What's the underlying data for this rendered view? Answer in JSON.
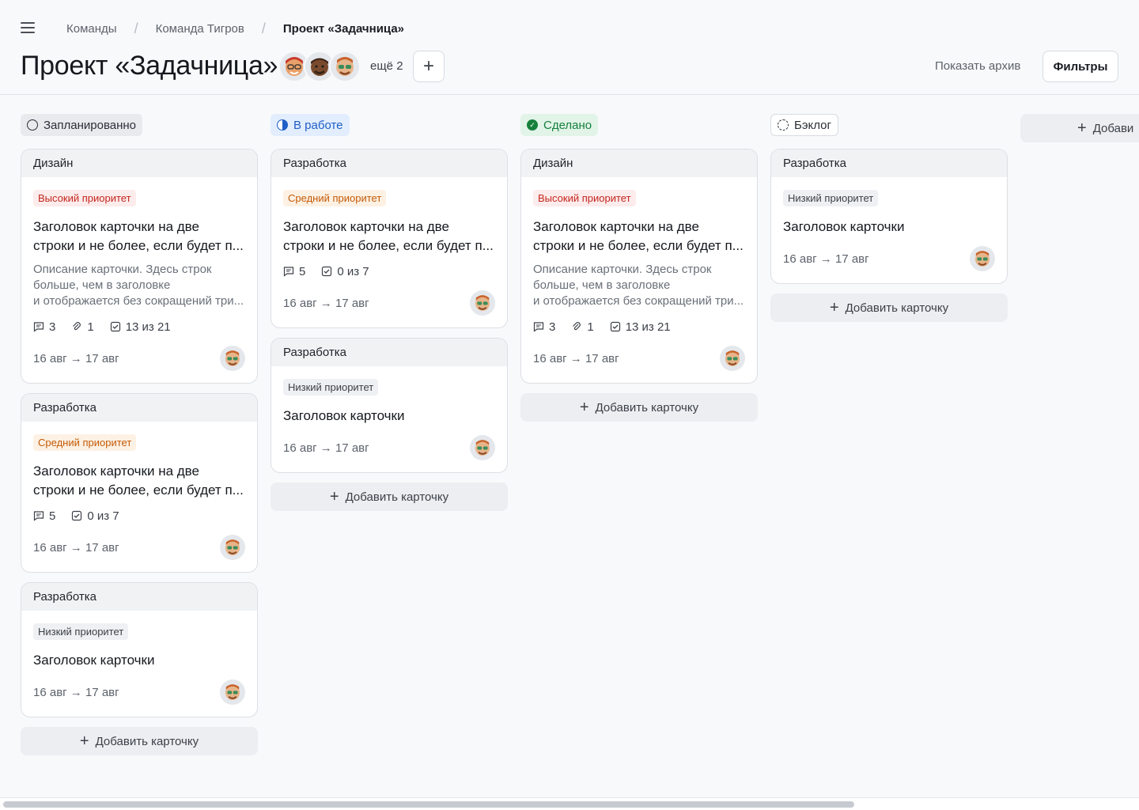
{
  "breadcrumb": [
    "Команды",
    "Команда Тигров",
    "Проект «Задачница»"
  ],
  "page": {
    "title": "Проект «Задачница»",
    "more_members": "ещё 2",
    "add_member": "+",
    "archive": "Показать архив",
    "filters": "Фильтры",
    "add_column": "Добави"
  },
  "add_card_label": "Добавить карточку",
  "columns": [
    {
      "status": "Запланированно",
      "cards": [
        {
          "category": "Дизайн",
          "priority": "Высокий приоритет",
          "title": "Заголовок карточки на две\nстроки и не более, если будет п...",
          "desc": "Описание карточки. Здесь строк\nбольше, чем в заголовке\nи отображается без сокращений три...",
          "comments": "3",
          "attachments": "1",
          "checklist": "13 из 21",
          "dates": "16 авг → 17 авг"
        },
        {
          "category": "Разработка",
          "priority": "Средний приоритет",
          "title": "Заголовок карточки на две\nстроки и не более, если будет п...",
          "comments": "5",
          "checklist": "0 из 7",
          "dates": "16 авг → 17 авг"
        },
        {
          "category": "Разработка",
          "priority": "Низкий приоритет",
          "title": "Заголовок карточки",
          "dates": "16 авг → 17 авг"
        }
      ]
    },
    {
      "status": "В работе",
      "cards": [
        {
          "category": "Разработка",
          "priority": "Средний приоритет",
          "title": "Заголовок карточки на две\nстроки и не более, если будет п...",
          "comments": "5",
          "checklist": "0 из 7",
          "dates": "16 авг → 17 авг"
        },
        {
          "category": "Разработка",
          "priority": "Низкий приоритет",
          "title": "Заголовок карточки",
          "dates": "16 авг → 17 авг"
        }
      ]
    },
    {
      "status": "Сделано",
      "cards": [
        {
          "category": "Дизайн",
          "priority": "Высокий приоритет",
          "title": "Заголовок карточки на две\nстроки и не более, если будет п...",
          "desc": "Описание карточки. Здесь строк\nбольше, чем в заголовке\nи отображается без сокращений три...",
          "comments": "3",
          "attachments": "1",
          "checklist": "13 из 21",
          "dates": "16 авг → 17 авг"
        }
      ]
    },
    {
      "status": "Бэклог",
      "cards": [
        {
          "category": "Разработка",
          "priority": "Низкий приоритет",
          "title": "Заголовок карточки",
          "dates": "16 авг → 17 авг"
        }
      ]
    }
  ],
  "colors": {
    "accent_blue": "#1f5fc7",
    "done_green": "#16803c",
    "high_red": "#c4261d",
    "mid_orange": "#c45a06"
  }
}
